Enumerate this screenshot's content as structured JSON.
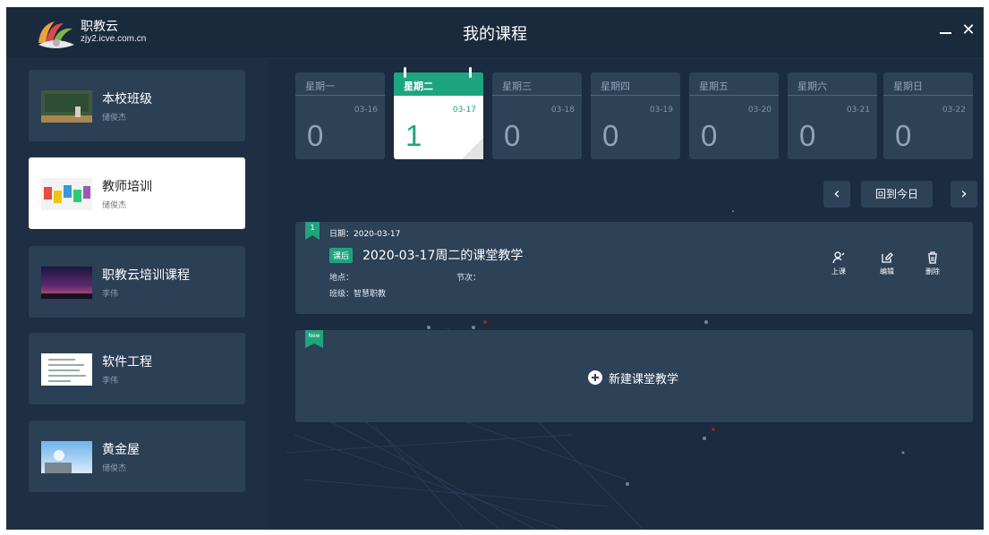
{
  "window": {
    "brand_name": "职教云",
    "brand_url": "zjy2.icve.com.cn",
    "title": "我的课程",
    "minimize_icon": "minimize-icon",
    "close_glyph": "✕"
  },
  "sidebar": {
    "courses": [
      {
        "title": "本校班级",
        "teacher": "储俊杰",
        "thumbnail": "classroom-image",
        "active": false
      },
      {
        "title": "教师培训",
        "teacher": "储俊杰",
        "thumbnail": "colorful-letters-image",
        "active": true
      },
      {
        "title": "职教云培训课程",
        "teacher": "李伟",
        "thumbnail": "night-sky-image",
        "active": false
      },
      {
        "title": "软件工程",
        "teacher": "李伟",
        "thumbnail": "document-image",
        "active": false
      },
      {
        "title": "黄金屋",
        "teacher": "储俊杰",
        "thumbnail": "sky-image",
        "active": false
      }
    ]
  },
  "calendar": {
    "days": [
      {
        "name": "星期一",
        "date": "03-16",
        "count": "0"
      },
      {
        "name": "星期二",
        "date": "03-17",
        "count": "1"
      },
      {
        "name": "星期三",
        "date": "03-18",
        "count": "0"
      },
      {
        "name": "星期四",
        "date": "03-19",
        "count": "0"
      },
      {
        "name": "星期五",
        "date": "03-20",
        "count": "0"
      },
      {
        "name": "星期六",
        "date": "03-21",
        "count": "0"
      },
      {
        "name": "星期日",
        "date": "03-22",
        "count": "0"
      }
    ],
    "active_index": 1,
    "prev_label": "‹",
    "today_label": "回到今日",
    "next_label": "›"
  },
  "lesson": {
    "flag_number": "1",
    "date": "日期：2020-03-17",
    "tag": "课后",
    "title": "2020-03-17周二的课堂教学",
    "location": "地点：",
    "period": "节次：",
    "class": "班级：智慧职教",
    "actions": [
      {
        "label": "上课",
        "icon": "start-class-icon"
      },
      {
        "label": "编辑",
        "icon": "edit-icon"
      },
      {
        "label": "删除",
        "icon": "delete-icon"
      }
    ]
  },
  "new_lesson": {
    "flag": "New",
    "label": "新建课堂教学"
  },
  "colors": {
    "accent": "#1ea47e",
    "card_bg": "#2d4157",
    "main_bg": "#1b2b40"
  }
}
